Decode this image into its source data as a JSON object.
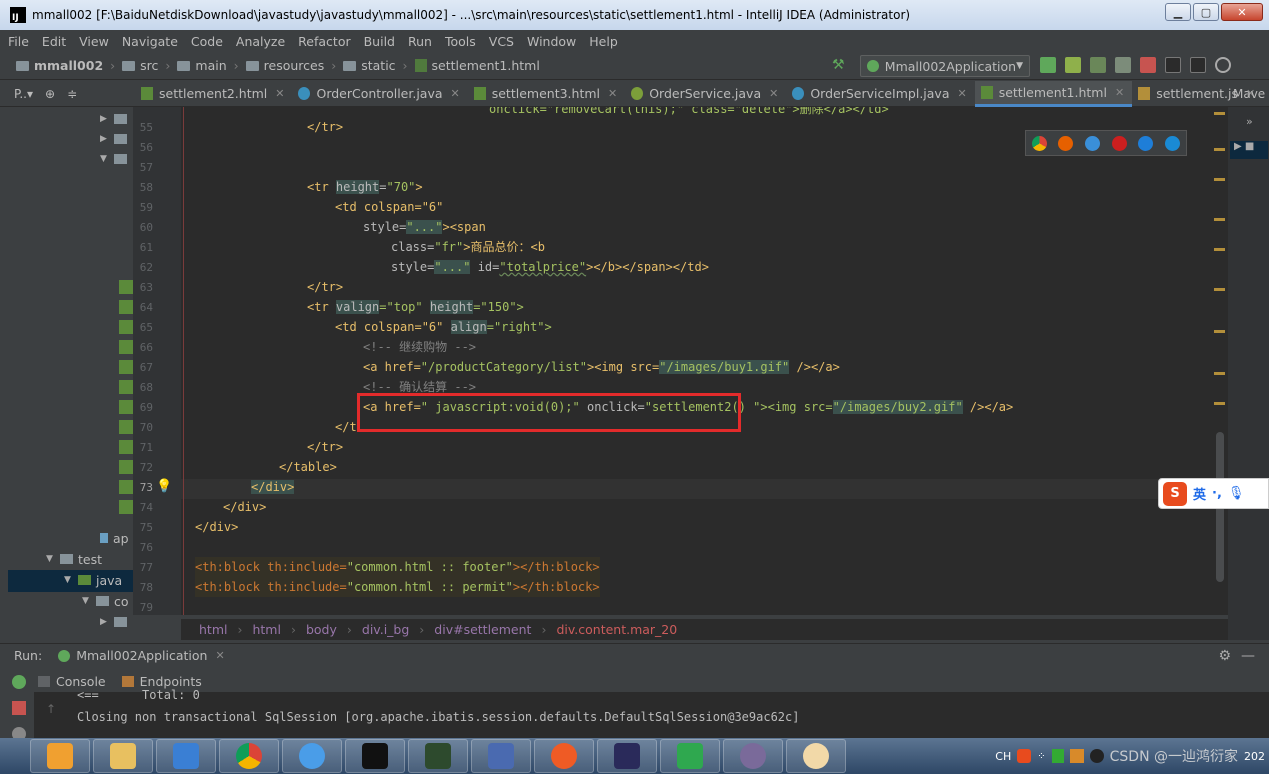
{
  "window": {
    "title": "mmall002 [F:\\BaiduNetdiskDownload\\javastudy\\javastudy\\mmall002] - ...\\src\\main\\resources\\static\\settlement1.html - IntelliJ IDEA (Administrator)",
    "app_icon": "IJ"
  },
  "menu": [
    "File",
    "Edit",
    "View",
    "Navigate",
    "Code",
    "Analyze",
    "Refactor",
    "Build",
    "Run",
    "Tools",
    "VCS",
    "Window",
    "Help"
  ],
  "nav_crumbs": [
    "mmall002",
    "src",
    "main",
    "resources",
    "static",
    "settlement1.html"
  ],
  "run_config": "Mmall002Application",
  "project_tools_label": "P..▾",
  "tabs": [
    {
      "label": "settlement2.html",
      "type": "html"
    },
    {
      "label": "OrderController.java",
      "type": "java"
    },
    {
      "label": "settlement3.html",
      "type": "html"
    },
    {
      "label": "OrderService.java",
      "type": "iface"
    },
    {
      "label": "OrderServiceImpl.java",
      "type": "java"
    },
    {
      "label": "settlement1.html",
      "type": "html",
      "active": true
    },
    {
      "label": "settlement.js",
      "type": "js"
    }
  ],
  "maven_label": "Mave",
  "tree": {
    "items": [
      {
        "label": "ap",
        "kind": "partial"
      },
      {
        "label": "test",
        "kind": "folder"
      },
      {
        "label": "java",
        "kind": "folder-blue"
      },
      {
        "label": "co",
        "kind": "folder"
      }
    ]
  },
  "editor": {
    "line_numbers": [
      "55",
      "56",
      "57",
      "58",
      "59",
      "60",
      "61",
      "62",
      "63",
      "64",
      "65",
      "66",
      "67",
      "68",
      "69",
      "70",
      "71",
      "72",
      "73",
      "74",
      "75",
      "76",
      "77",
      "78",
      "79"
    ],
    "current_line": "73",
    "top_partial": "onclick=\"removeCart(this);\" class=\"delete\">删除</a></td>"
  },
  "code_texts": {
    "l55": "</tr>",
    "l58_tag": "<tr ",
    "l58_attr": "height",
    "l58_val": "\"70\"",
    "l59": "<td colspan=\"6\"",
    "l60_a": "style=",
    "l60_b": "\"...\"",
    "l60_c": "><span",
    "l61_a": "class=",
    "l61_b": "\"fr\"",
    "l61_c": ">商品总价：<b",
    "l62_a": "style=",
    "l62_b": "\"...\"",
    "l62_c": " id=",
    "l62_d": "\"totalprice\"",
    "l62_e": "></b></span></td>",
    "l63": "</tr>",
    "l64_a": "<tr ",
    "l64_b": "valign",
    "l64_c": "=\"top\" ",
    "l64_d": "height",
    "l64_e": "=\"150\">",
    "l65_a": "<td colspan=\"6\" ",
    "l65_b": "align",
    "l65_c": "=\"right\">",
    "l66": "<!-- 继续购物 -->",
    "l67_a": "<a href=",
    "l67_b": "\"/productCategory/list\"",
    "l67_c": "><img src=",
    "l67_d": "\"/images/buy1.gif\"",
    "l67_e": " /></a>",
    "l68": "<!-- 确认结算 -->",
    "l69_a": "<a href=",
    "l69_b": "\" javascript:void(0);\"",
    "l69_c": " onclick=",
    "l69_d": "\"settlement2()",
    "l69_e": " \"><img src=",
    "l69_f": "\"/images/buy2.gif\"",
    "l69_g": " /></a>",
    "l70": "</t",
    "l71": "</tr>",
    "l72": "</table>",
    "l73": "</div>",
    "l74": "</div>",
    "l75": "</div>",
    "l77_a": "<th:block ",
    "l77_b": "th:include=",
    "l77_c": "\"common.html :: footer\"",
    "l77_d": "></th:block>",
    "l78_a": "<th:block ",
    "l78_b": "th:include=",
    "l78_c": "\"common.html :: permit\"",
    "l78_d": "></th:block>"
  },
  "breadcrumbs": [
    "html",
    "html",
    "body",
    "div.i_bg",
    "div#settlement",
    "div.content.mar_20"
  ],
  "run_panel": {
    "label": "Run:",
    "config": "Mmall002Application",
    "subtabs": [
      "Console",
      "Endpoints"
    ],
    "console_lines": [
      "<==      Total: 0",
      "Closing non transactional SqlSession [org.apache.ibatis.session.defaults.DefaultSqlSession@3e9ac62c]"
    ]
  },
  "ime": {
    "logo": "S",
    "lang": "英",
    "punct": "·,"
  },
  "tray": {
    "lang": "CH",
    "watermark": "CSDN @一辿鸿衍家",
    "time_partial": "202"
  },
  "colors": {
    "accent": "#4a88c7",
    "highlight_box": "#e32b2b"
  }
}
